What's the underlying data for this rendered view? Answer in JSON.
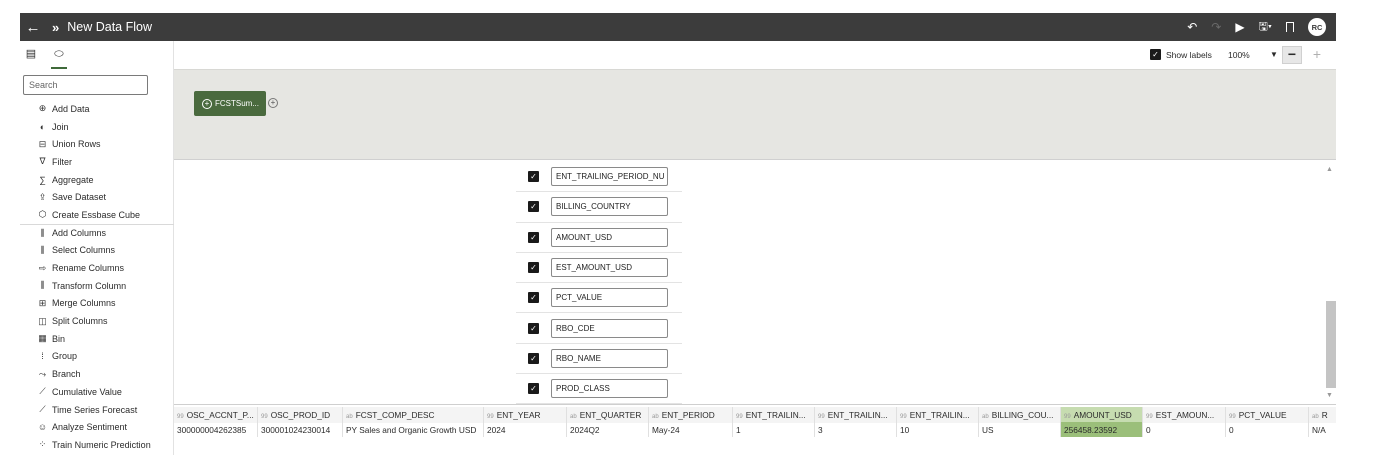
{
  "titlebar": {
    "back_icon": "←",
    "chevrons_icon": "»",
    "title": "New Data Flow",
    "undo_icon": "↶",
    "redo_icon": "↷",
    "run_icon": "▶",
    "save_icon": "🖫▾",
    "avatar": "RC"
  },
  "left_panel": {
    "tab_data_icon": "▤",
    "tab_steps_icon": "⬭",
    "search_placeholder": "Search",
    "operations": [
      {
        "icon": "⊕",
        "label": "Add Data"
      },
      {
        "icon": "◐",
        "label": "Join"
      },
      {
        "icon": "⊟",
        "label": "Union Rows"
      },
      {
        "icon": "∇",
        "label": "Filter"
      },
      {
        "icon": "∑",
        "label": "Aggregate"
      },
      {
        "icon": "⇪",
        "label": "Save Dataset"
      },
      {
        "icon": "⬡",
        "label": "Create Essbase Cube"
      },
      {
        "icon": "⫼",
        "label": "Add Columns"
      },
      {
        "icon": "⫼",
        "label": "Select Columns"
      },
      {
        "icon": "⇨",
        "label": "Rename Columns"
      },
      {
        "icon": "⫼",
        "label": "Transform Column"
      },
      {
        "icon": "⊞",
        "label": "Merge Columns"
      },
      {
        "icon": "◫",
        "label": "Split Columns"
      },
      {
        "icon": "▦",
        "label": "Bin"
      },
      {
        "icon": "⁞",
        "label": "Group"
      },
      {
        "icon": "⤳",
        "label": "Branch"
      },
      {
        "icon": "⟋",
        "label": "Cumulative Value"
      },
      {
        "icon": "⟋",
        "label": "Time Series Forecast"
      },
      {
        "icon": "☺",
        "label": "Analyze Sentiment"
      },
      {
        "icon": "⁘",
        "label": "Train Numeric Prediction"
      }
    ]
  },
  "toolbar": {
    "show_labels": "Show labels",
    "zoom_value": "100%",
    "zoom_dropdown": "▼",
    "zoom_out": "−",
    "zoom_in": "+",
    "check": "✓"
  },
  "canvas": {
    "node_label": "FCSTSum...",
    "node_plus": "+",
    "add_step": "+"
  },
  "columns": [
    "ENT_TRAILING_PERIOD_NU",
    "BILLING_COUNTRY",
    "AMOUNT_USD",
    "EST_AMOUNT_USD",
    "PCT_VALUE",
    "RBO_CDE",
    "RBO_NAME",
    "PROD_CLASS"
  ],
  "scroll": {
    "up": "▲",
    "down": "▼"
  },
  "grid": {
    "headers": [
      {
        "type": "99",
        "label": "OSC_ACCNT_P..."
      },
      {
        "type": "99",
        "label": "OSC_PROD_ID"
      },
      {
        "type": "ab",
        "label": "FCST_COMP_DESC"
      },
      {
        "type": "99",
        "label": "ENT_YEAR"
      },
      {
        "type": "ab",
        "label": "ENT_QUARTER"
      },
      {
        "type": "ab",
        "label": "ENT_PERIOD"
      },
      {
        "type": "99",
        "label": "ENT_TRAILIN..."
      },
      {
        "type": "99",
        "label": "ENT_TRAILIN..."
      },
      {
        "type": "99",
        "label": "ENT_TRAILIN..."
      },
      {
        "type": "ab",
        "label": "BILLING_COU..."
      },
      {
        "type": "99",
        "label": "AMOUNT_USD"
      },
      {
        "type": "99",
        "label": "EST_AMOUN..."
      },
      {
        "type": "99",
        "label": "PCT_VALUE"
      },
      {
        "type": "ab",
        "label": "R"
      }
    ],
    "row": [
      "300000004262385",
      "300001024230014",
      "PY Sales and Organic Growth USD",
      "2024",
      "2024Q2",
      "May-24",
      "1",
      "3",
      "10",
      "US",
      "256458.23592",
      "0",
      "0",
      "N/A"
    ]
  }
}
